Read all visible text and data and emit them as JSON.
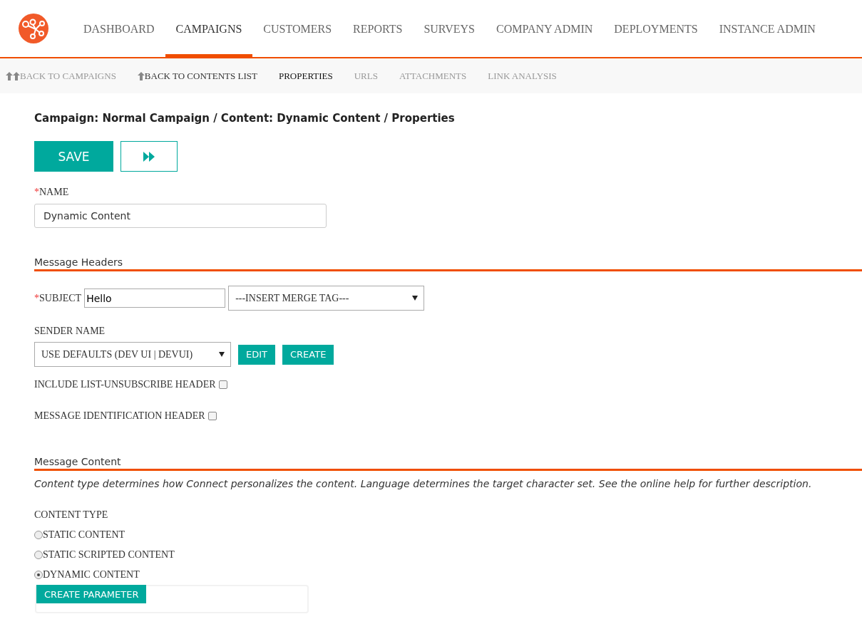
{
  "nav": {
    "items": [
      {
        "label": "DASHBOARD",
        "selected": false
      },
      {
        "label": "CAMPAIGNS",
        "selected": true
      },
      {
        "label": "CUSTOMERS",
        "selected": false
      },
      {
        "label": "REPORTS",
        "selected": false
      },
      {
        "label": "SURVEYS",
        "selected": false
      },
      {
        "label": "COMPANY ADMIN",
        "selected": false
      },
      {
        "label": "DEPLOYMENTS",
        "selected": false
      },
      {
        "label": "INSTANCE ADMIN",
        "selected": false
      }
    ]
  },
  "subnav": {
    "items": [
      {
        "label": "BACK TO CAMPAIGNS",
        "kind": "back2",
        "selected": false,
        "disabled": true
      },
      {
        "label": "BACK TO CONTENTS LIST",
        "kind": "back1",
        "selected": false,
        "disabled": false
      },
      {
        "label": "PROPERTIES",
        "kind": "tab",
        "selected": true,
        "disabled": false
      },
      {
        "label": "URLS",
        "kind": "tab",
        "selected": false,
        "disabled": true
      },
      {
        "label": "ATTACHMENTS",
        "kind": "tab",
        "selected": false,
        "disabled": true
      },
      {
        "label": "LINK ANALYSIS",
        "kind": "tab",
        "selected": false,
        "disabled": true
      }
    ]
  },
  "breadcrumb": "Campaign: Normal Campaign / Content: Dynamic Content / Properties",
  "actions": {
    "save": "SAVE"
  },
  "name_field": {
    "required_mark": "*",
    "label": "NAME",
    "value": "Dynamic Content"
  },
  "message_headers": {
    "title": "Message Headers",
    "subject": {
      "required_mark": "*",
      "label": "SUBJECT",
      "value": "Hello",
      "merge_tag": "---INSERT MERGE TAG---"
    },
    "sender_name": {
      "label": "SENDER NAME",
      "value": "USE DEFAULTS (DEV UI | DEVUI)",
      "buttons": [
        "EDIT",
        "CREATE"
      ]
    },
    "checkboxes": [
      {
        "label": "INCLUDE LIST-UNSUBSCRIBE HEADER",
        "checked": false
      },
      {
        "label": "MESSAGE IDENTIFICATION HEADER",
        "checked": false
      }
    ]
  },
  "message_content": {
    "title": "Message Content",
    "description": "Content type determines how Connect personalizes the content. Language determines the target character set. See the online help for further description.",
    "content_type": {
      "label": "CONTENT TYPE",
      "options": [
        {
          "label": "STATIC CONTENT",
          "selected": false
        },
        {
          "label": "STATIC SCRIPTED CONTENT",
          "selected": false
        },
        {
          "label": "DYNAMIC CONTENT",
          "selected": true
        }
      ]
    },
    "create_parameter": "CREATE PARAMETER"
  }
}
